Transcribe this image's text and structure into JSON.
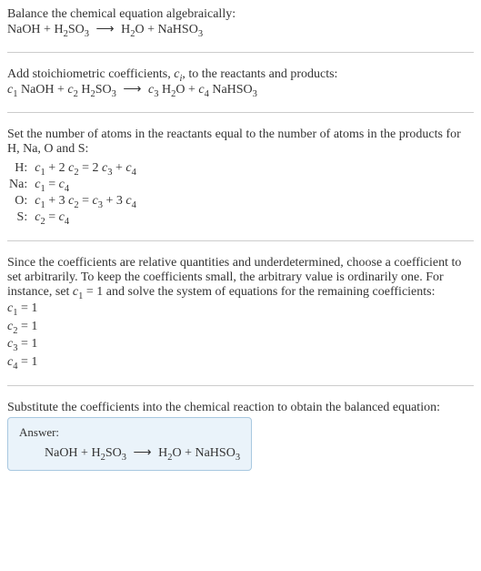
{
  "intro": {
    "line1": "Balance the chemical equation algebraically:"
  },
  "eq1": {
    "lhs1": "NaOH",
    "plus1": " + ",
    "lhs2": "H",
    "lhs2sub": "2",
    "lhs3": "SO",
    "lhs3sub": "3",
    "arrow": " ⟶ ",
    "rhs1": "H",
    "rhs1sub": "2",
    "rhs2": "O",
    "plus2": " + ",
    "rhs3": "NaHSO",
    "rhs3sub": "3"
  },
  "stoich": {
    "text1a": "Add stoichiometric coefficients, ",
    "text1b": ", to the reactants and products:"
  },
  "ci": {
    "c": "c",
    "i": "i"
  },
  "eq2": {
    "c1": "c",
    "s1": "1",
    "sp1": " NaOH + ",
    "c2": "c",
    "s2": "2",
    "sp2": " H",
    "sp2sub": "2",
    "sp2b": "SO",
    "sp2bsub": "3",
    "arrow": " ⟶ ",
    "c3": "c",
    "s3": "3",
    "sp3": " H",
    "sp3sub": "2",
    "sp3b": "O + ",
    "c4": "c",
    "s4": "4",
    "sp4": " NaHSO",
    "sp4sub": "3"
  },
  "atoms": {
    "intro": "Set the number of atoms in the reactants equal to the number of atoms in the products for H, Na, O and S:",
    "rows": [
      {
        "el": "H:",
        "c1": "c",
        "s1": "1",
        "t1": " + 2 ",
        "c2": "c",
        "s2": "2",
        "t2": " = 2 ",
        "c3": "c",
        "s3": "3",
        "t3": " + ",
        "c4": "c",
        "s4": "4",
        "t4": ""
      },
      {
        "el": "Na:",
        "c1": "c",
        "s1": "1",
        "t1": " = ",
        "c2": "c",
        "s2": "4",
        "t2": "",
        "c3": "",
        "s3": "",
        "t3": "",
        "c4": "",
        "s4": "",
        "t4": ""
      },
      {
        "el": "O:",
        "c1": "c",
        "s1": "1",
        "t1": " + 3 ",
        "c2": "c",
        "s2": "2",
        "t2": " = ",
        "c3": "c",
        "s3": "3",
        "t3": " + 3 ",
        "c4": "c",
        "s4": "4",
        "t4": ""
      },
      {
        "el": "S:",
        "c1": "c",
        "s1": "2",
        "t1": " = ",
        "c2": "c",
        "s2": "4",
        "t2": "",
        "c3": "",
        "s3": "",
        "t3": "",
        "c4": "",
        "s4": "",
        "t4": ""
      }
    ]
  },
  "solve": {
    "p1a": "Since the coefficients are relative quantities and underdetermined, choose a coefficient to set arbitrarily. To keep the coefficients small, the arbitrary value is ordinarily one. For instance, set ",
    "p1b": " = 1 and solve the system of equations for the remaining coefficients:",
    "c1c": "c",
    "c1s": "1",
    "lines": [
      {
        "c": "c",
        "s": "1",
        "v": " = 1"
      },
      {
        "c": "c",
        "s": "2",
        "v": " = 1"
      },
      {
        "c": "c",
        "s": "3",
        "v": " = 1"
      },
      {
        "c": "c",
        "s": "4",
        "v": " = 1"
      }
    ]
  },
  "final": {
    "text": "Substitute the coefficients into the chemical reaction to obtain the balanced equation:"
  },
  "answer": {
    "label": "Answer:",
    "lhs1": "NaOH",
    "plus1": " + ",
    "lhs2": "H",
    "lhs2sub": "2",
    "lhs3": "SO",
    "lhs3sub": "3",
    "arrow": " ⟶ ",
    "rhs1": "H",
    "rhs1sub": "2",
    "rhs2": "O",
    "plus2": " + ",
    "rhs3": "NaHSO",
    "rhs3sub": "3"
  }
}
